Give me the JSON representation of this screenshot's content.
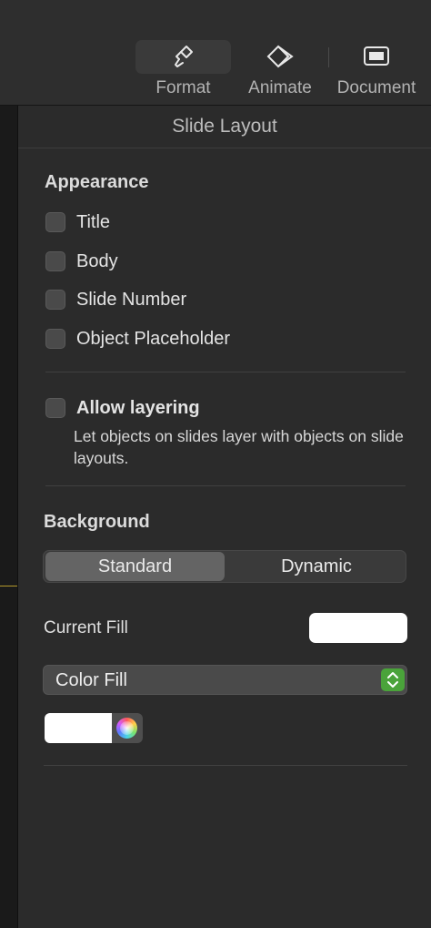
{
  "toolbar": {
    "format_label": "Format",
    "animate_label": "Animate",
    "document_label": "Document",
    "format_icon": "paintbrush-icon",
    "animate_icon": "diamond-icon",
    "document_icon": "document-icon"
  },
  "panel": {
    "title": "Slide Layout",
    "appearance": {
      "heading": "Appearance",
      "options": [
        {
          "label": "Title",
          "checked": false
        },
        {
          "label": "Body",
          "checked": false
        },
        {
          "label": "Slide Number",
          "checked": false
        },
        {
          "label": "Object Placeholder",
          "checked": false
        }
      ]
    },
    "layering": {
      "label": "Allow layering",
      "checked": false,
      "description": "Let objects on slides layer with objects on slide layouts."
    },
    "background": {
      "heading": "Background",
      "segments": [
        "Standard",
        "Dynamic"
      ],
      "selected_segment": "Standard",
      "current_fill_label": "Current Fill",
      "current_fill_color": "#ffffff",
      "fill_type": "Color Fill",
      "fill_color": "#ffffff"
    }
  },
  "colors": {
    "accent_green": "#4aa33a",
    "panel_bg": "#2b2b2b"
  }
}
